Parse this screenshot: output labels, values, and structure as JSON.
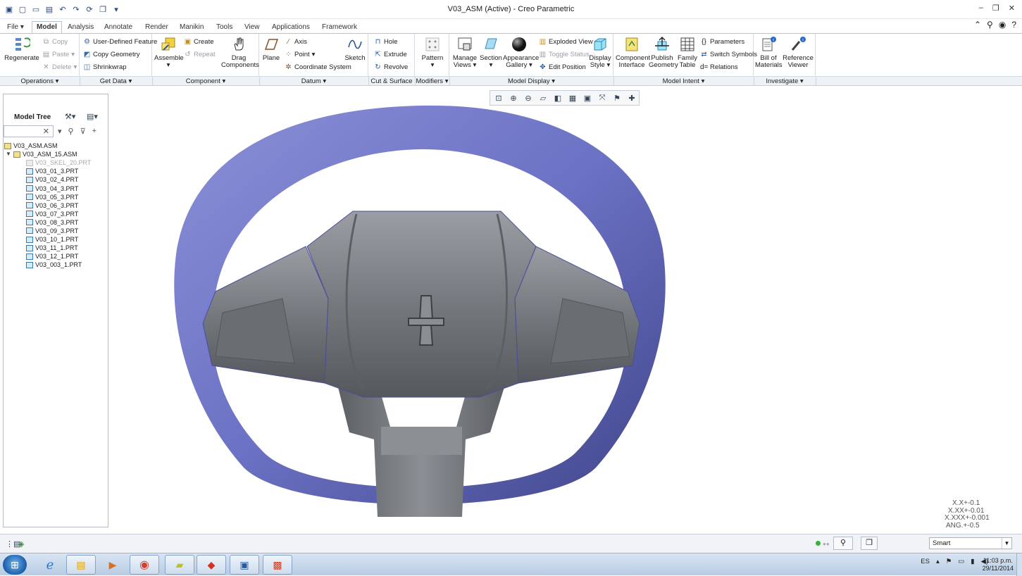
{
  "window": {
    "title": "V03_ASM (Active) - Creo Parametric"
  },
  "menu": {
    "file": "File ▾",
    "tabs": [
      "Model",
      "Analysis",
      "Annotate",
      "Render",
      "Manikin",
      "Tools",
      "View",
      "Applications",
      "Framework"
    ]
  },
  "ribbon": {
    "operations": {
      "regenerate": "Regenerate",
      "copy": "Copy",
      "paste": "Paste",
      "delete": "Delete"
    },
    "getdata": {
      "udf": "User-Defined Feature",
      "copy_geometry": "Copy Geometry",
      "shrinkwrap": "Shrinkwrap"
    },
    "component": {
      "assemble": "Assemble",
      "create": "Create",
      "repeat": "Repeat",
      "drag1": "Drag",
      "drag2": "Components"
    },
    "datum": {
      "plane": "Plane",
      "axis": "Axis",
      "point": "Point",
      "csys": "Coordinate System",
      "sketch": "Sketch"
    },
    "cut": {
      "hole": "Hole",
      "extrude": "Extrude",
      "revolve": "Revolve"
    },
    "modifiers": {
      "pattern": "Pattern"
    },
    "display": {
      "manage1": "Manage",
      "manage2": "Views",
      "section": "Section",
      "appearance1": "Appearance",
      "appearance2": "Gallery",
      "exploded": "Exploded View",
      "toggle": "Toggle Status",
      "edit_position": "Edit Position",
      "dstyle1": "Display",
      "dstyle2": "Style"
    },
    "intent": {
      "ci1": "Component",
      "ci2": "Interface",
      "pg1": "Publish",
      "pg2": "Geometry",
      "ft1": "Family",
      "ft2": "Table",
      "parameters": "Parameters",
      "switch": "Switch Symbols",
      "relations": "Relations"
    },
    "investigate": {
      "bom1": "Bill of",
      "bom2": "Materials",
      "rv1": "Reference",
      "rv2": "Viewer"
    }
  },
  "groups": [
    "Operations ▾",
    "Get Data ▾",
    "Component ▾",
    "Datum ▾",
    "Cut & Surface ▾",
    "Modifiers ▾",
    "Model Display ▾",
    "Model Intent ▾",
    "Investigate ▾"
  ],
  "tree": {
    "title": "Model Tree",
    "items": [
      {
        "label": "V03_ASM.ASM",
        "kind": "asm",
        "level": 0
      },
      {
        "label": "V03_ASM_15.ASM",
        "kind": "asm",
        "level": 1
      },
      {
        "label": "V03_SKEL_20.PRT",
        "kind": "dim",
        "level": 2
      },
      {
        "label": "V03_01_3.PRT",
        "kind": "prt",
        "level": 2
      },
      {
        "label": "V03_02_4.PRT",
        "kind": "prt",
        "level": 2
      },
      {
        "label": "V03_04_3.PRT",
        "kind": "prt",
        "level": 2
      },
      {
        "label": "V03_05_3.PRT",
        "kind": "prt",
        "level": 2
      },
      {
        "label": "V03_06_3.PRT",
        "kind": "prt",
        "level": 2
      },
      {
        "label": "V03_07_3.PRT",
        "kind": "prt",
        "level": 2
      },
      {
        "label": "V03_08_3.PRT",
        "kind": "prt",
        "level": 2
      },
      {
        "label": "V03_09_3.PRT",
        "kind": "prt",
        "level": 2
      },
      {
        "label": "V03_10_1.PRT",
        "kind": "prt",
        "level": 2
      },
      {
        "label": "V03_11_1.PRT",
        "kind": "prt",
        "level": 2
      },
      {
        "label": "V03_12_1.PRT",
        "kind": "prt",
        "level": 2
      },
      {
        "label": "V03_003_1.PRT",
        "kind": "prt",
        "level": 2
      }
    ]
  },
  "tolerances": [
    "X.X+-0.1",
    "X.XX+-0.01",
    "X.XXX+-0.001",
    "ANG.+-0.5"
  ],
  "status": {
    "filter": "Smart"
  },
  "taskbar": {
    "lang": "ES",
    "time": "11:03 p.m.",
    "date": "29/11/2014"
  },
  "colors": {
    "accent": "#2a5a9a",
    "wheel": "#6f75c7",
    "hub": "#6e7277"
  }
}
